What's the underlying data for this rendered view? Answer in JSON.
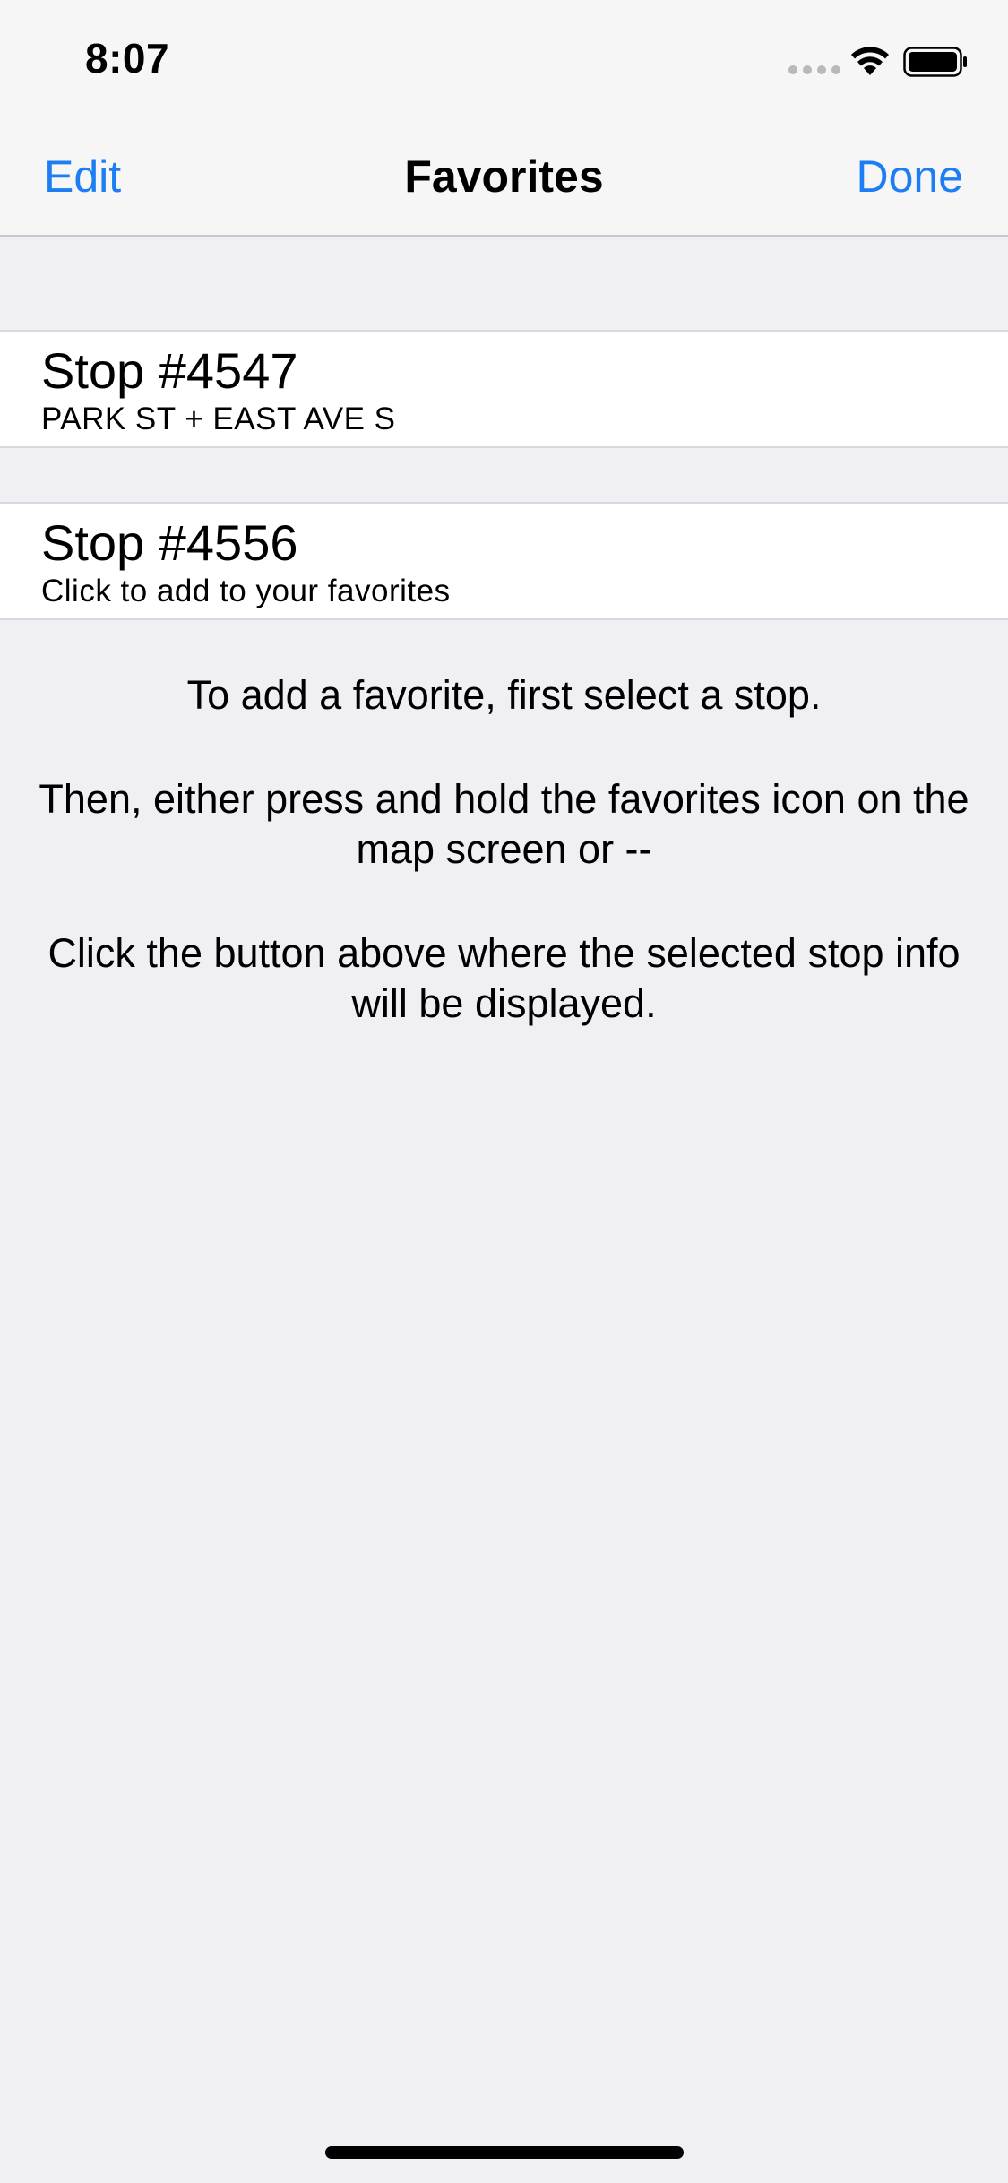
{
  "status_bar": {
    "time": "8:07",
    "icons": [
      "signal-dots-icon",
      "wifi-icon",
      "battery-icon"
    ]
  },
  "nav": {
    "edit_label": "Edit",
    "title": "Favorites",
    "done_label": "Done"
  },
  "favorites": [
    {
      "title": "Stop #4547",
      "subtitle": "PARK ST + EAST AVE S"
    },
    {
      "title": "Stop #4556",
      "subtitle": "Click to add to your favorites"
    }
  ],
  "help": {
    "line1": "To add a favorite, first select a stop.",
    "line2": "Then, either press and hold the favorites icon on the map screen or --",
    "line3": "Click the button above where the selected stop info will be displayed."
  },
  "colors": {
    "accent": "#1c7ef2",
    "background": "#efeff4",
    "bar": "#f6f6f6"
  }
}
